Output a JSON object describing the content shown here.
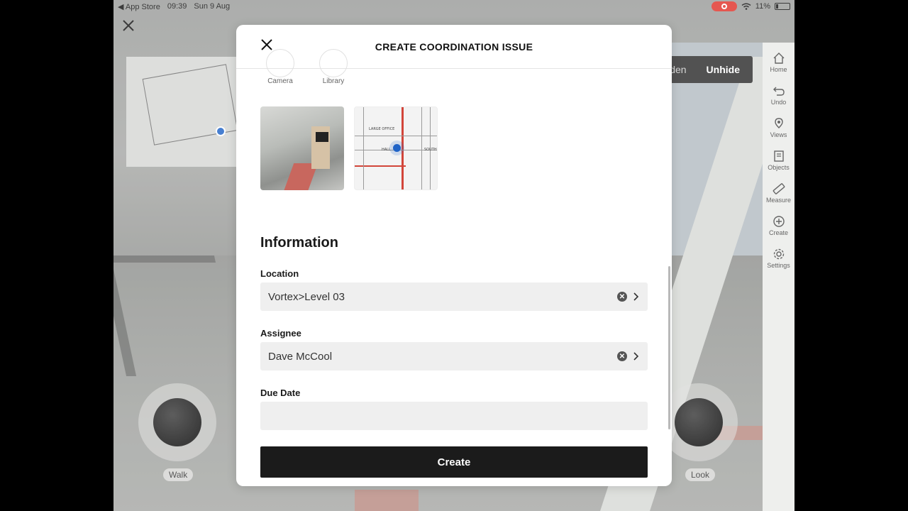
{
  "status_bar": {
    "back_app": "◀ App Store",
    "time": "09:39",
    "date": "Sun 9 Aug",
    "battery": "11%"
  },
  "visibility": {
    "hidden_label": "den",
    "unhide_label": "Unhide"
  },
  "toolbar": {
    "items": [
      {
        "label": "Home",
        "icon": "home-icon"
      },
      {
        "label": "Undo",
        "icon": "undo-icon"
      },
      {
        "label": "Views",
        "icon": "views-icon"
      },
      {
        "label": "Objects",
        "icon": "objects-icon"
      },
      {
        "label": "Measure",
        "icon": "measure-icon"
      },
      {
        "label": "Create",
        "icon": "create-icon"
      },
      {
        "label": "Settings",
        "icon": "settings-icon"
      }
    ]
  },
  "joysticks": {
    "walk_label": "Walk",
    "look_label": "Look"
  },
  "modal": {
    "title": "CREATE COORDINATION ISSUE",
    "sources": {
      "camera_label": "Camera",
      "library_label": "Library"
    },
    "attachments": [
      {
        "type": "photo",
        "icon": "photo-thumbnail"
      },
      {
        "type": "plan",
        "icon": "plan-thumbnail",
        "texts": [
          "LARGE OFFICE",
          "HALL",
          "SOUTH"
        ]
      }
    ],
    "section_title": "Information",
    "location": {
      "label": "Location",
      "value": "Vortex>Level 03"
    },
    "assignee": {
      "label": "Assignee",
      "value": "Dave McCool"
    },
    "due_date": {
      "label": "Due Date",
      "value": ""
    },
    "create_label": "Create"
  },
  "colors": {
    "accent": "#1f63c7",
    "button_dark": "#1b1b1b",
    "field_bg": "#efefef"
  }
}
